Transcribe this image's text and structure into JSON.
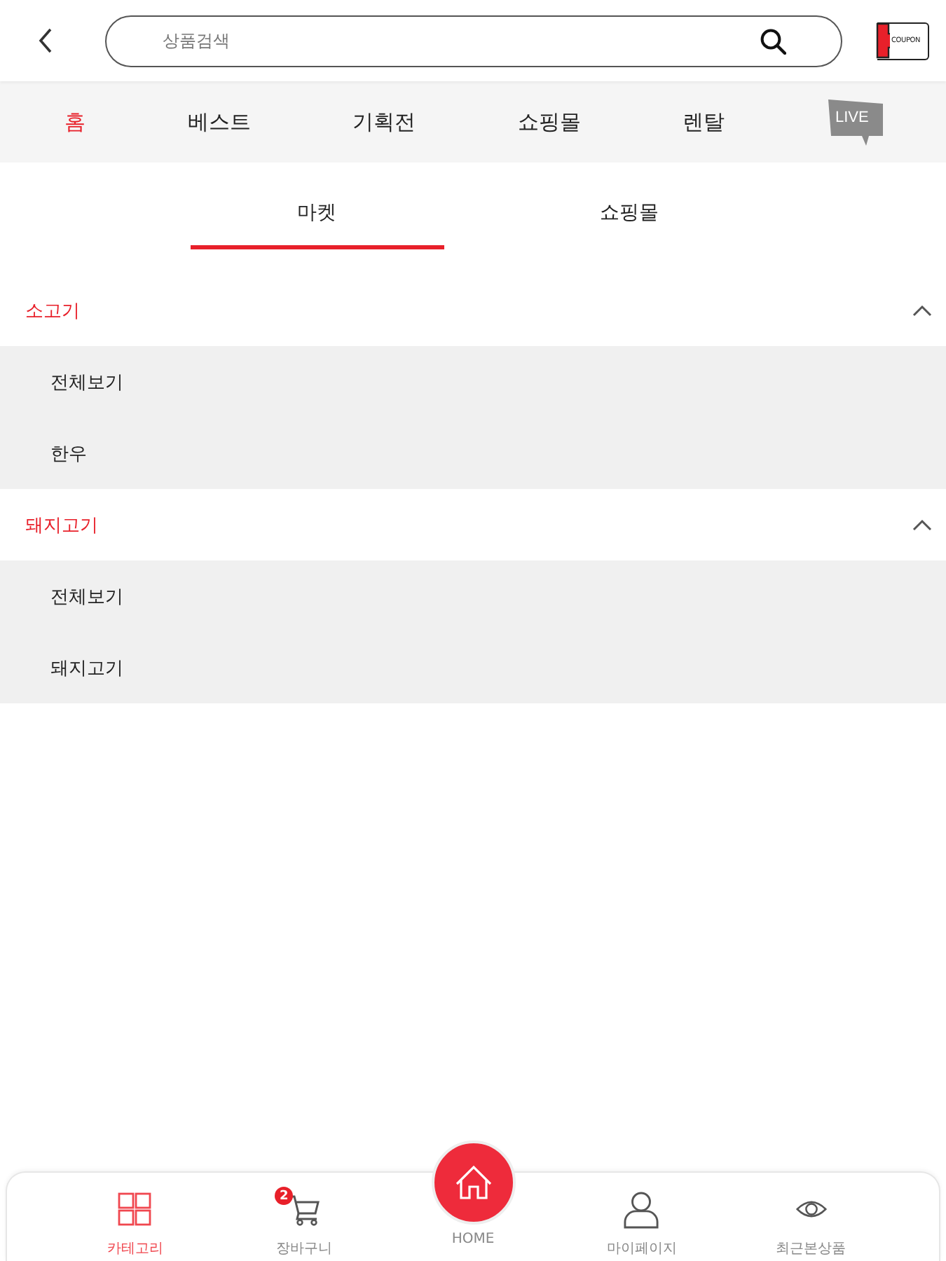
{
  "header": {
    "search": {
      "placeholder": "상품검색"
    },
    "coupon_label": "COUPON"
  },
  "main_nav": [
    {
      "label": "홈",
      "selected": true
    },
    {
      "label": "베스트",
      "selected": false
    },
    {
      "label": "기획전",
      "selected": false
    },
    {
      "label": "쇼핑몰",
      "selected": false
    },
    {
      "label": "렌탈",
      "selected": false
    }
  ],
  "live_label": "LIVE",
  "sub_tabs": [
    {
      "label": "마켓",
      "selected": true
    },
    {
      "label": "쇼핑몰",
      "selected": false
    }
  ],
  "categories": [
    {
      "title": "소고기",
      "expanded": true,
      "items": [
        "전체보기",
        "한우"
      ]
    },
    {
      "title": "돼지고기",
      "expanded": true,
      "items": [
        "전체보기",
        "돼지고기"
      ]
    }
  ],
  "bottom_nav": [
    {
      "kind": "grid",
      "label": "카테고리",
      "selected": true
    },
    {
      "kind": "cart",
      "label": "장바구니",
      "selected": false,
      "badge": "2"
    },
    {
      "kind": "home",
      "label": "HOME",
      "selected": false
    },
    {
      "kind": "person",
      "label": "마이페이지",
      "selected": false
    },
    {
      "kind": "eye",
      "label": "최근본상품",
      "selected": false
    }
  ]
}
